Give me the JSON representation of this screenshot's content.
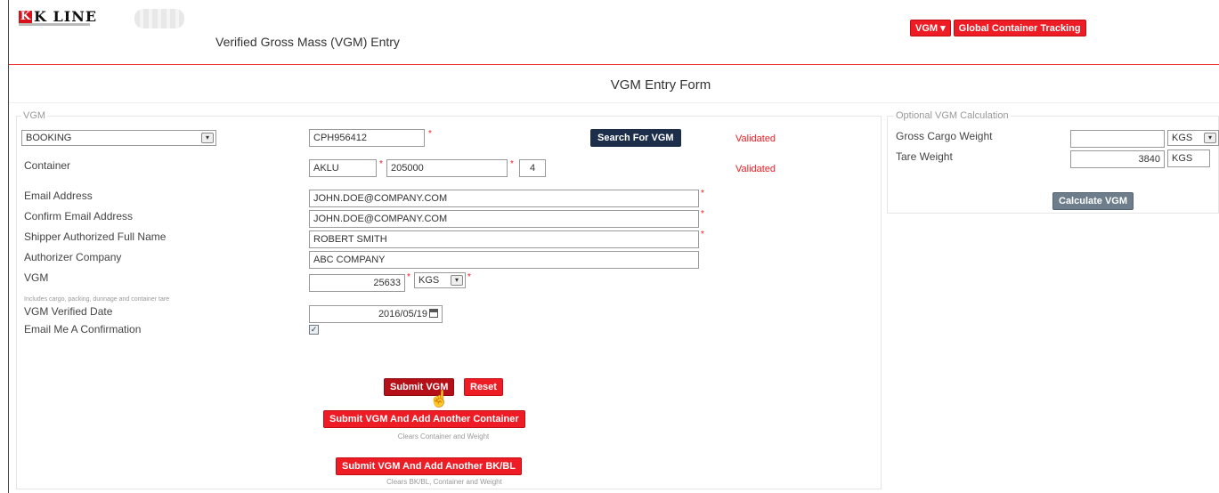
{
  "header": {
    "brand": "K LINE",
    "brand_letter": "K",
    "page_title": "Verified Gross Mass (VGM) Entry",
    "nav": {
      "vgm_menu": "VGM ▾",
      "tracking": "Global Container Tracking"
    },
    "accent_color": "#ee1c24"
  },
  "form": {
    "title": "VGM Entry Form",
    "legend": "VGM",
    "lookup_type": "BOOKING",
    "booking_number": "CPH956412",
    "search_button": "Search For VGM",
    "booking_status": "Validated",
    "container": {
      "label": "Container",
      "prefix": "AKLU",
      "number": "205000",
      "check_digit": "4",
      "status": "Validated"
    },
    "email": {
      "label": "Email Address",
      "value": "JOHN.DOE@COMPANY.COM"
    },
    "confirm_email": {
      "label": "Confirm Email Address",
      "value": "JOHN.DOE@COMPANY.COM"
    },
    "shipper_name": {
      "label": "Shipper Authorized Full Name",
      "value": "ROBERT SMITH"
    },
    "company": {
      "label": "Authorizer Company",
      "value": "ABC COMPANY"
    },
    "vgm": {
      "label": "VGM",
      "note": "Includes cargo, packing, dunnage and container tare",
      "value": "25633",
      "unit": "KGS"
    },
    "verified_date": {
      "label": "VGM Verified Date",
      "value": "2016/05/19"
    },
    "email_confirmation": {
      "label": "Email Me A Confirmation",
      "checked": true
    },
    "required_mark": "*",
    "buttons": {
      "submit": "Submit VGM",
      "reset": "Reset",
      "submit_add_container": "Submit VGM And Add Another Container",
      "submit_add_container_note": "Clears Container and Weight",
      "submit_add_bkbl": "Submit VGM And Add Another BK/BL",
      "submit_add_bkbl_note": "Clears BK/BL, Container and Weight"
    }
  },
  "calc": {
    "legend": "Optional VGM Calculation",
    "gross_label": "Gross Cargo Weight",
    "gross_value": "",
    "gross_unit": "KGS",
    "tare_label": "Tare Weight",
    "tare_value": "3840",
    "tare_unit": "KGS",
    "button": "Calculate VGM"
  }
}
